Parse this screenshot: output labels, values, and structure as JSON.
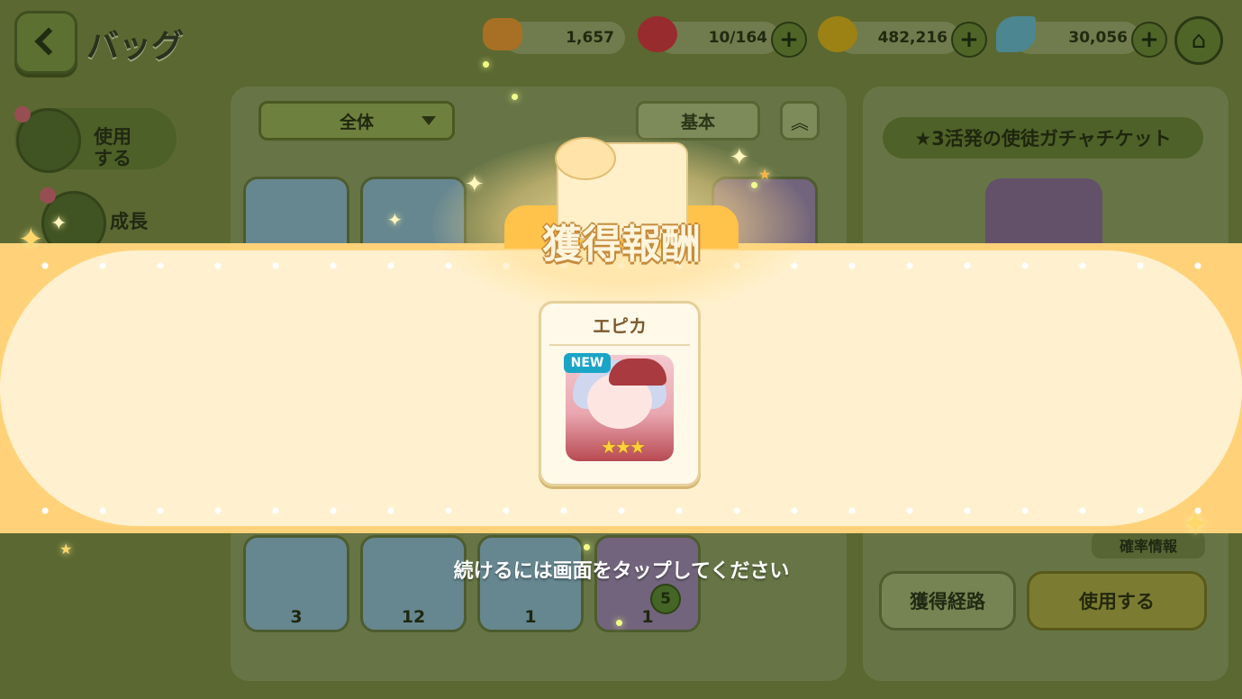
{
  "header": {
    "title": "バッグ",
    "resources": [
      {
        "name": "bread",
        "value": "1,657",
        "color": "#d9892a"
      },
      {
        "name": "stamina-candy",
        "value": "10/164",
        "color": "#c42a36"
      },
      {
        "name": "coin",
        "value": "482,216",
        "color": "#c9a116"
      },
      {
        "name": "leaf",
        "value": "30,056",
        "color": "#5aa8c0"
      }
    ],
    "plus_label": "+",
    "home_icon": "⌂"
  },
  "sidebar": {
    "items": [
      {
        "label": "使用する",
        "line1": "使用",
        "line2": "する"
      },
      {
        "label": "成長"
      }
    ]
  },
  "inventory": {
    "filter_label": "全体",
    "sort_label": "基本",
    "collapse_icon": "︽",
    "bottom_items": [
      {
        "count": "3",
        "color": "#8fb8d6"
      },
      {
        "count": "12",
        "color": "#8fb8d6"
      },
      {
        "count": "1",
        "color": "#8fb8d6"
      },
      {
        "count": "1",
        "color": "#9d86b4"
      }
    ],
    "green_badge": "5"
  },
  "detail": {
    "item_name": "★3活発の使徒ガチャチケット",
    "probability_label": "確率情報",
    "acquire_route_label": "獲得経路",
    "use_label": "使用する"
  },
  "reward": {
    "title": "獲得報酬",
    "character_name": "エピカ",
    "new_badge": "NEW",
    "stars": "★★★",
    "continue_hint": "続けるには画面をタップしてください"
  }
}
